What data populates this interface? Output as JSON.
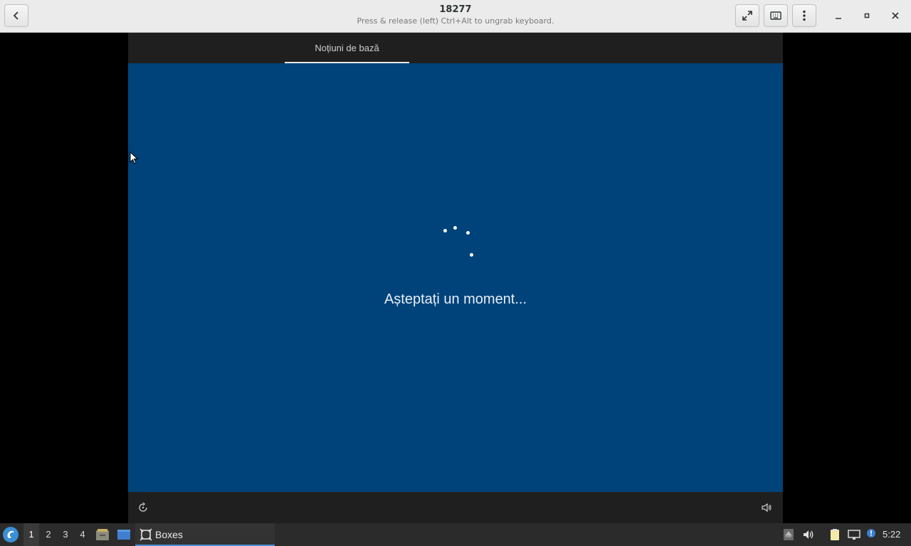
{
  "window": {
    "title": "18277",
    "subtitle": "Press & release (left) Ctrl+Alt to ungrab keyboard."
  },
  "vm": {
    "tab_label": "Noțiuni de bază",
    "status_text": "Așteptați un moment..."
  },
  "taskbar": {
    "workspaces": [
      "1",
      "2",
      "3",
      "4"
    ],
    "active_workspace": "1",
    "task_label": "Boxes",
    "clock": "5:22"
  },
  "colors": {
    "vm_background": "#00437a",
    "accent": "#4a90d9"
  }
}
